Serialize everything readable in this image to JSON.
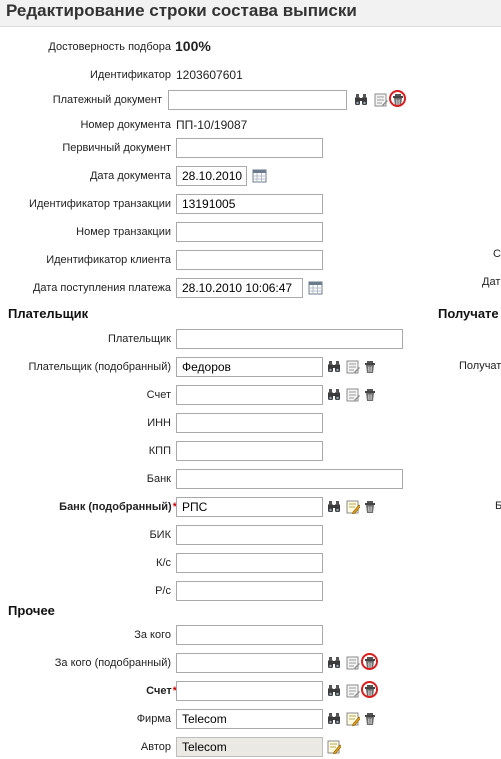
{
  "page": {
    "title": "Редактирование строки состава выписки"
  },
  "colors": {
    "accent_red": "#d81e1e",
    "required": "#d40000",
    "title_bg": "#f2f2f2"
  },
  "header": {
    "reliability_label": "Достоверность подбора",
    "reliability_value": "100%",
    "identifier_label": "Идентификатор",
    "identifier_value": "1203607601",
    "payment_doc_label": "Платежный документ",
    "payment_doc_value": "",
    "doc_number_label": "Номер документа",
    "doc_number_value": "ПП-10/19087",
    "primary_doc_label": "Первичный документ",
    "primary_doc_value": "",
    "doc_date_label": "Дата документа",
    "doc_date_value": "28.10.2010",
    "transaction_id_label": "Идентификатор транзакции",
    "transaction_id_value": "13191005",
    "transaction_number_label": "Номер транзакции",
    "transaction_number_value": "",
    "client_id_label": "Идентификатор клиента",
    "client_id_value": "",
    "receipt_date_label": "Дата поступления платежа",
    "receipt_date_value": "28.10.2010 10:06:47"
  },
  "payer": {
    "section_title": "Плательщик",
    "payer_label": "Плательщик",
    "payer_value": "",
    "payer_matched_label": "Плательщик (подобранный)",
    "payer_matched_value": "Федоров",
    "account_label": "Счет",
    "account_value": "",
    "inn_label": "ИНН",
    "inn_value": "",
    "kpp_label": "КПП",
    "kpp_value": "",
    "bank_label": "Банк",
    "bank_value": "",
    "bank_matched_label": "Банк (подобранный)",
    "bank_matched_value": "РПС",
    "bik_label": "БИК",
    "bik_value": "",
    "ks_label": "К/с",
    "ks_value": "",
    "rs_label": "Р/с",
    "rs_value": ""
  },
  "other": {
    "section_title": "Прочее",
    "for_whom_label": "За кого",
    "for_whom_value": "",
    "for_whom_matched_label": "За кого (подобранный)",
    "for_whom_matched_value": "",
    "account_label": "Счет",
    "account_value": "",
    "firm_label": "Фирма",
    "firm_value": "Telecom",
    "author_label": "Автор",
    "author_value": "Telecom"
  },
  "right_column_cut": {
    "label_1": "Ст",
    "label_2": "Дат",
    "section_title": "Получате",
    "label_3": "Получат",
    "label_4": "Б"
  },
  "icons": {
    "find": "binoculars-icon",
    "select": "list-select-icon",
    "edit": "pencil-note-icon",
    "delete": "trash-icon",
    "calendar": "calendar-icon"
  }
}
